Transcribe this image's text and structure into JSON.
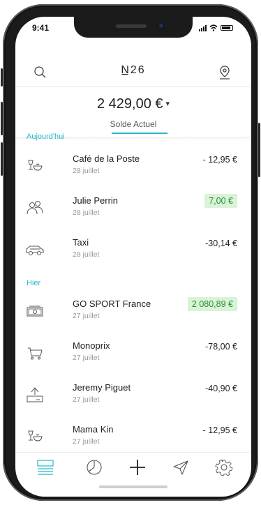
{
  "status_bar": {
    "time": "9:41"
  },
  "header": {
    "logo": "N̲26"
  },
  "balance": {
    "amount": "2 429,00 €",
    "caret": "▾",
    "label": "Solde Actuel"
  },
  "sections": [
    {
      "title": "Aujourd'hui",
      "transactions": [
        {
          "name": "Café de la Poste",
          "date": "28 juillet",
          "amount": "- 12,95 €",
          "positive": false,
          "icon": "restaurant-icon"
        },
        {
          "name": "Julie Perrin",
          "date": "28 juillet",
          "amount": "7,00 €",
          "positive": true,
          "icon": "people-icon"
        },
        {
          "name": "Taxi",
          "date": "28 juillet",
          "amount": "-30,14 €",
          "positive": false,
          "icon": "car-icon"
        }
      ]
    },
    {
      "title": "Hier",
      "transactions": [
        {
          "name": "GO SPORT France",
          "date": "27 juillet",
          "amount": "2 080,89 €",
          "positive": true,
          "icon": "cash-icon"
        },
        {
          "name": "Monoprix",
          "date": "27 juillet",
          "amount": "-78,00 €",
          "positive": false,
          "icon": "cart-icon"
        },
        {
          "name": "Jeremy Piguet",
          "date": "27 juillet",
          "amount": "-40,90 €",
          "positive": false,
          "icon": "transfer-out-icon"
        },
        {
          "name": "Mama Kin",
          "date": "27 juillet",
          "amount": "- 12,95 €",
          "positive": false,
          "icon": "restaurant-icon"
        }
      ]
    }
  ],
  "tabbar": [
    {
      "name": "transactions",
      "icon": "list-icon",
      "active": true
    },
    {
      "name": "stats",
      "icon": "pie-chart-icon",
      "active": false
    },
    {
      "name": "add",
      "icon": "plus-icon",
      "active": false
    },
    {
      "name": "send",
      "icon": "send-icon",
      "active": false
    },
    {
      "name": "settings",
      "icon": "gear-icon",
      "active": false
    }
  ],
  "colors": {
    "accent": "#29b6c8",
    "positive_bg": "#d8f3d6",
    "positive_text": "#2a8c3c",
    "text": "#222222",
    "muted": "#999999"
  }
}
